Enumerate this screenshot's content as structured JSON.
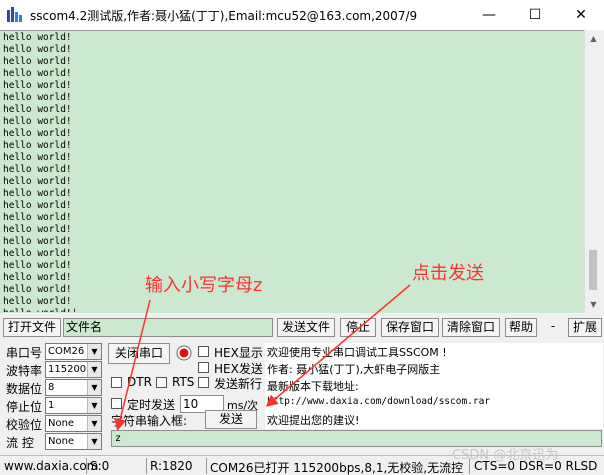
{
  "window": {
    "title": "sscom4.2测试版,作者:聂小猛(丁丁),Email:mcu52@163.com,2007/9",
    "minimize": "—",
    "maximize": "☐",
    "close": "✕"
  },
  "receive": {
    "lines": [
      "hello world!",
      "hello world!",
      "hello world!",
      "hello world!",
      "hello world!",
      "hello world!",
      "hello world!",
      "hello world!",
      "hello world!",
      "hello world!",
      "hello world!",
      "hello world!",
      "hello world!",
      "hello world!",
      "hello world!",
      "hello world!",
      "hello world!",
      "hello world!",
      "hello world!",
      "hello world!",
      "hello world!",
      "hello world!",
      "hello world!"
    ],
    "last_line": "hello world!|"
  },
  "toolbar": {
    "open_file": "打开文件",
    "file_name": "文件名",
    "send_file": "发送文件",
    "stop": "停止",
    "save_window": "保存窗口",
    "clear_window": "清除窗口",
    "help": "帮助",
    "minus": "-",
    "expand": "扩展"
  },
  "settings": {
    "port_label": "串口号",
    "port_value": "COM26",
    "baud_label": "波特率",
    "baud_value": "115200",
    "data_label": "数据位",
    "data_value": "8",
    "stop_label": "停止位",
    "stop_value": "1",
    "parity_label": "校验位",
    "parity_value": "None",
    "flow_label": "流 控",
    "flow_value": "None"
  },
  "controls": {
    "close_port": "关闭串口",
    "hex_display": "HEX显示",
    "hex_send": "HEX发送",
    "send_newline": "发送新行",
    "dtr": "DTR",
    "rts": "RTS",
    "timed_send": "定时发送",
    "period_value": "10",
    "period_unit": "ms/次",
    "input_label": "字符串输入框:",
    "send_button": "发送",
    "send_text": "z"
  },
  "info": {
    "line1": "欢迎使用专业串口调试工具SSCOM !",
    "line2": "作者: 聂小猛(丁丁),大虾电子网版主",
    "line3": "最新版本下载地址:",
    "line4": "http://www.daxia.com/download/sscom.rar",
    "line5": "欢迎提出您的建议!"
  },
  "status": {
    "site": "www.daxia.com",
    "s": "S:0",
    "r": "R:1820",
    "port_state": "COM26已打开  115200bps,8,1,无校验,无流控",
    "lines": "CTS=0 DSR=0 RLSD"
  },
  "annotations": {
    "lowercase": "输入小写字母z",
    "click_send": "点击发送",
    "watermark": "CSDN @北京迅为"
  },
  "colors": {
    "receive_bg": "#cce8cf",
    "annotation": "#ff3030"
  }
}
